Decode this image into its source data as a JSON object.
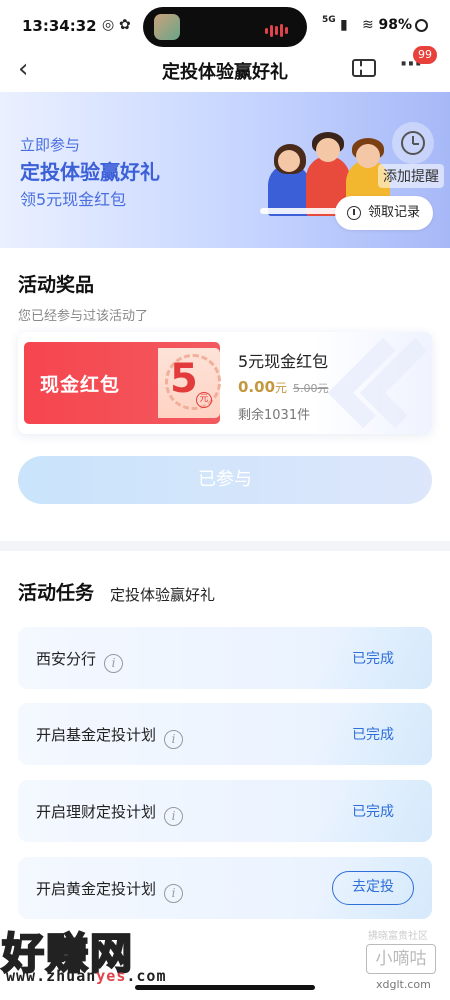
{
  "status_bar": {
    "time": "13:34:32",
    "network": "5G",
    "battery": "98%"
  },
  "nav": {
    "title": "定投体验赢好礼",
    "badge": "99"
  },
  "banner": {
    "line1": "立即参与",
    "line2": "定投体验赢好礼",
    "line3": "领5元现金红包",
    "reminder_label": "添加提醒",
    "records_label": "领取记录"
  },
  "rewards": {
    "title": "活动奖品",
    "subtitle": "您已经参与过该活动了",
    "coupon_label": "现金红包",
    "coupon_value": "5",
    "coupon_unit": "元",
    "prize_name": "5元现金红包",
    "price": "0.00",
    "price_unit": "元",
    "original_price": "5.00元",
    "stock": "剩余1031件",
    "joined_button": "已参与"
  },
  "tasks": {
    "title": "活动任务",
    "subtitle": "定投体验赢好礼",
    "items": [
      {
        "name": "西安分行",
        "status": "已完成"
      },
      {
        "name": "开启基金定投计划",
        "status": "已完成"
      },
      {
        "name": "开启理财定投计划",
        "status": "已完成"
      },
      {
        "name": "开启黄金定投计划",
        "status": "去定投"
      }
    ]
  },
  "watermarks": {
    "left_big": "好赚网",
    "left_url_a": "www.zhuan",
    "left_url_b": "yes",
    "left_url_c": ".com",
    "right_small": "拂晓富贵社区",
    "right_big": "小嘀咕",
    "right_url": "xdglt.com"
  },
  "icons": [
    "back-icon",
    "ticket-icon",
    "more-icon",
    "clock-icon",
    "records-icon",
    "info-icon"
  ],
  "colors": {
    "accent": "#2f6fd8",
    "coupon_red": "#f6454e",
    "price_gold": "#c4983f"
  }
}
